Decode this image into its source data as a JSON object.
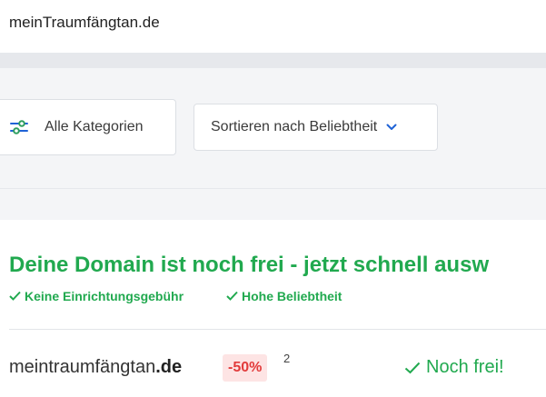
{
  "search": {
    "value": "meinTraumfängtan.de"
  },
  "filters": {
    "categories_label": "Alle Kategorien",
    "sort_label": "Sortieren nach Beliebtheit"
  },
  "colors": {
    "green": "#21a94f",
    "blue": "#1f63d6",
    "discount_bg": "#fde4e4",
    "discount_text": "#e23b3b"
  },
  "result": {
    "headline": "Deine Domain ist noch frei - jetzt schnell ausw",
    "features": [
      {
        "label": "Keine Einrichtungsgebühr"
      },
      {
        "label": "Hohe Beliebtheit"
      }
    ],
    "domain": {
      "name": "meintraumfängtan",
      "tld": ".de"
    },
    "discount": "-50%",
    "footnote": "2",
    "status": "Noch frei!"
  }
}
